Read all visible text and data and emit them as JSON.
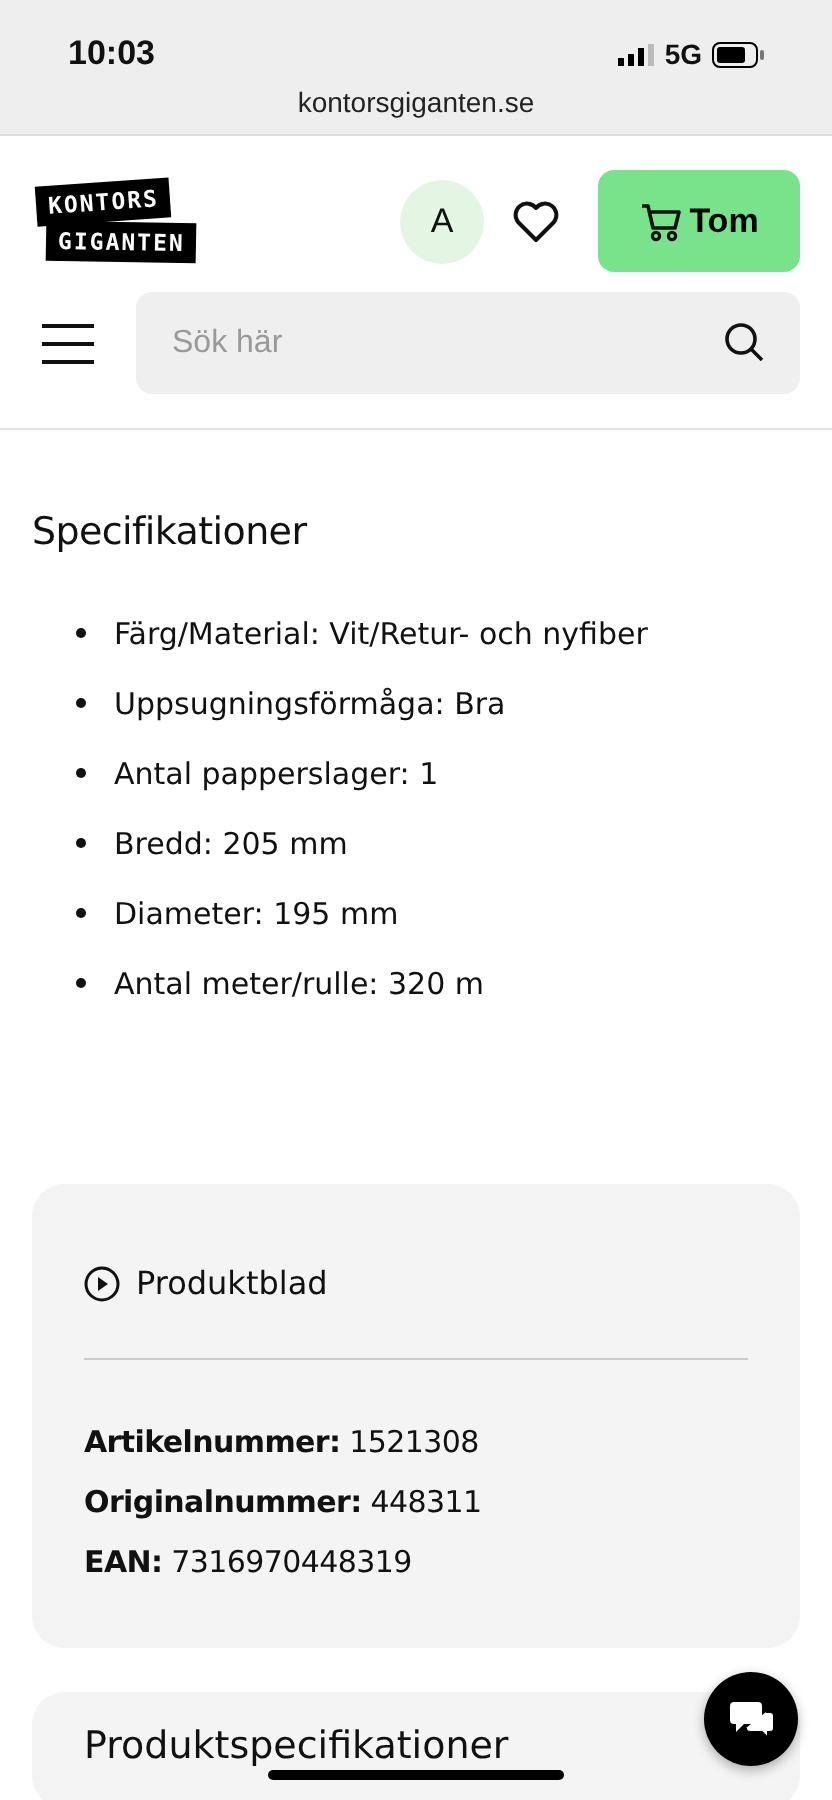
{
  "status_bar": {
    "time": "10:03",
    "network": "5G"
  },
  "browser": {
    "url": "kontorsgiganten.se"
  },
  "header": {
    "logo_lines": [
      "KONTORS",
      "GIGANTEN"
    ],
    "account_initial": "A",
    "cart_label": "Tom"
  },
  "search": {
    "placeholder": "Sök här"
  },
  "specs": {
    "title": "Specifikationer",
    "items": [
      "Färg/Material: Vit/Retur- och nyfiber",
      "Uppsugningsförmåga: Bra",
      "Antal papperslager: 1",
      "Bredd: 205 mm",
      "Diameter: 195 mm",
      "Antal meter/rulle: 320 m"
    ]
  },
  "info_card": {
    "link": "Produktblad",
    "lines": [
      "**Artikelnummer:** 1521308",
      "**Originalnummer:** 448311",
      "**EAN:** 7316970448319"
    ]
  },
  "next_card": {
    "title": "Produktspecifikationer"
  }
}
